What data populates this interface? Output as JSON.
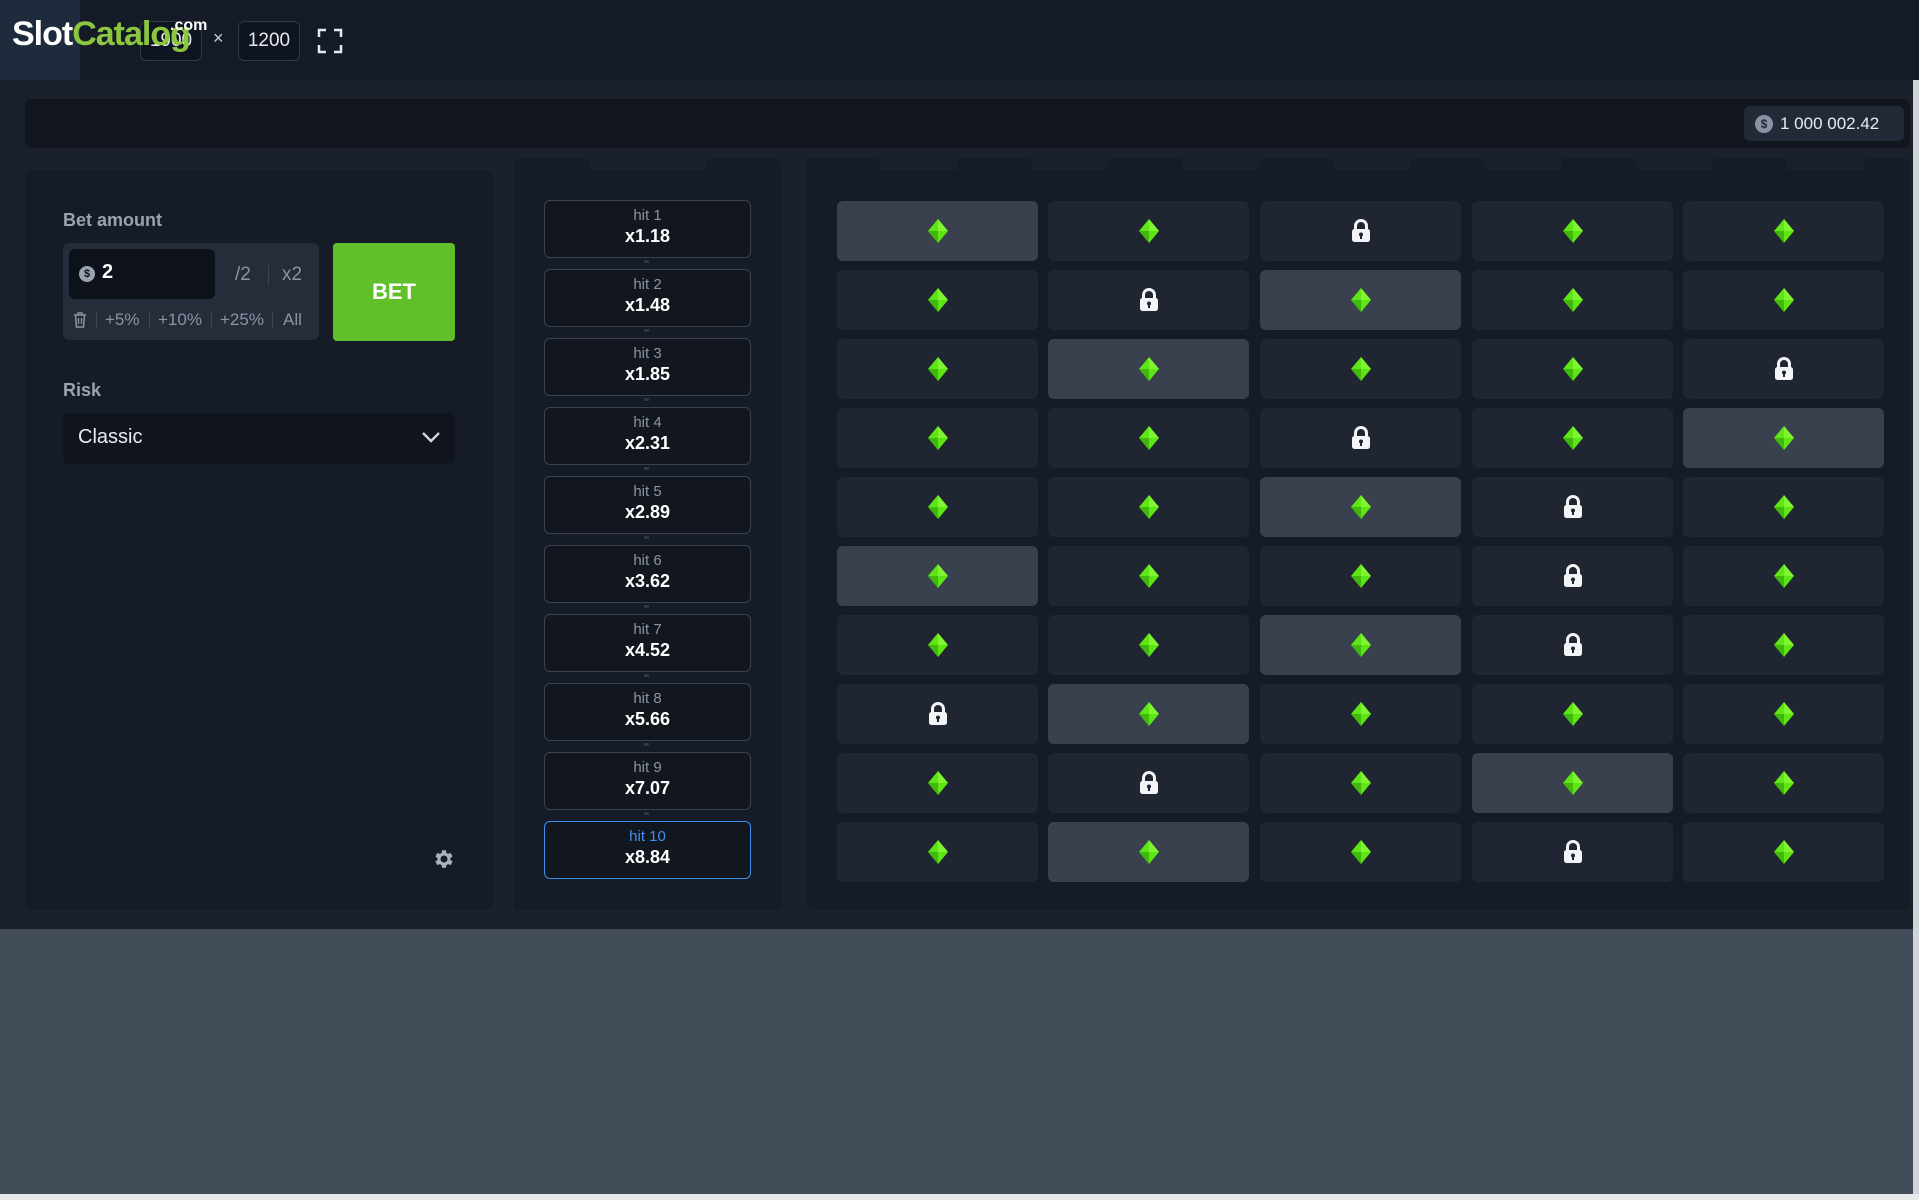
{
  "header": {
    "logo": {
      "slot": "Slot",
      "catalog": "Catalog",
      "dotcom": ".com"
    },
    "width_value": "1900",
    "height_value": "1200",
    "times": "×"
  },
  "balance": {
    "amount": "1 000 002.42",
    "currency_icon": "dollar-coin-icon"
  },
  "bet_panel": {
    "bet_label": "Bet amount",
    "bet_value": "2",
    "half": "/2",
    "double": "x2",
    "quick": [
      "+5%",
      "+10%",
      "+25%",
      "All"
    ],
    "bet_button": "BET",
    "risk_label": "Risk",
    "risk_value": "Classic"
  },
  "hits": [
    {
      "label": "hit 1",
      "mult": "x1.18"
    },
    {
      "label": "hit 2",
      "mult": "x1.48"
    },
    {
      "label": "hit 3",
      "mult": "x1.85"
    },
    {
      "label": "hit 4",
      "mult": "x2.31"
    },
    {
      "label": "hit 5",
      "mult": "x2.89"
    },
    {
      "label": "hit 6",
      "mult": "x3.62"
    },
    {
      "label": "hit 7",
      "mult": "x4.52"
    },
    {
      "label": "hit 8",
      "mult": "x5.66"
    },
    {
      "label": "hit 9",
      "mult": "x7.07"
    },
    {
      "label": "hit 10",
      "mult": "x8.84"
    }
  ],
  "active_hit": 10,
  "grid": {
    "rows": [
      [
        "gem",
        "gem",
        "lock",
        "gem",
        "gem"
      ],
      [
        "gem",
        "lock",
        "gem",
        "gem",
        "gem"
      ],
      [
        "gem",
        "gem",
        "gem",
        "gem",
        "lock"
      ],
      [
        "gem",
        "gem",
        "lock",
        "gem",
        "gem"
      ],
      [
        "gem",
        "gem",
        "gem",
        "lock",
        "gem"
      ],
      [
        "gem",
        "gem",
        "gem",
        "lock",
        "gem"
      ],
      [
        "gem",
        "gem",
        "gem",
        "lock",
        "gem"
      ],
      [
        "lock",
        "gem",
        "gem",
        "gem",
        "gem"
      ],
      [
        "gem",
        "lock",
        "gem",
        "gem",
        "gem"
      ],
      [
        "gem",
        "gem",
        "gem",
        "lock",
        "gem"
      ]
    ],
    "highlighted_column_per_row": [
      1,
      3,
      2,
      5,
      3,
      1,
      3,
      2,
      4,
      2
    ]
  },
  "colors": {
    "gem": "#5ee614",
    "bet_button": "#5fc02a",
    "active_hit": "#3e8ff0",
    "logo_green": "#8cc63f"
  }
}
